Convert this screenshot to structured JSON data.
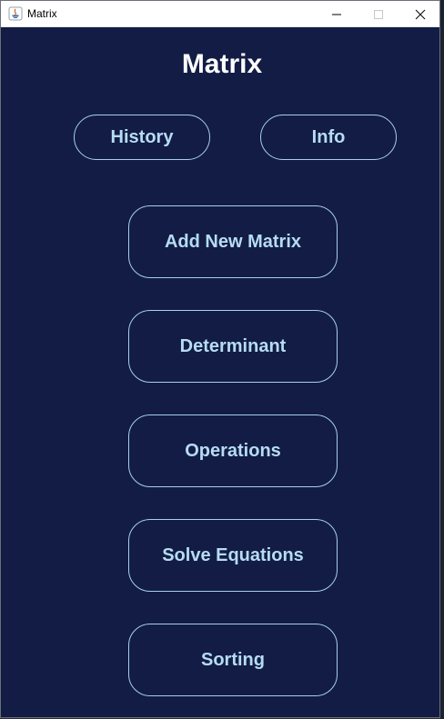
{
  "window": {
    "title": "Matrix",
    "background": "#121c45",
    "accent": "#b6dcf3",
    "controls": {
      "minimize_icon": "minimize-icon",
      "maximize_icon": "maximize-icon",
      "close_icon": "close-icon"
    }
  },
  "app": {
    "title": "Matrix",
    "top_buttons": {
      "history": "History",
      "info": "Info"
    },
    "menu": {
      "add_new_matrix": "Add New Matrix",
      "determinant": "Determinant",
      "operations": "Operations",
      "solve_equations": "Solve Equations",
      "sorting": "Sorting"
    }
  }
}
